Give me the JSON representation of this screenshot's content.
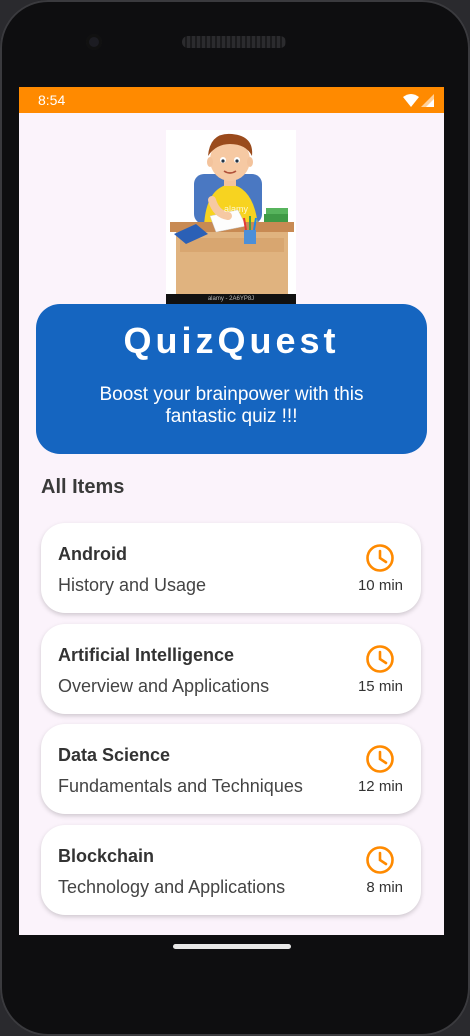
{
  "status": {
    "time": "8:54"
  },
  "hero": {
    "image_caption": "alamy - 2A6YP8J",
    "watermark": "alamy"
  },
  "banner": {
    "title": "QuizQuest",
    "subtitle": "Boost your brainpower with this fantastic quiz !!!"
  },
  "section": {
    "title": "All Items"
  },
  "items": [
    {
      "title": "Android",
      "subtitle": "History and Usage",
      "time": "10 min"
    },
    {
      "title": "Artificial Intelligence",
      "subtitle": "Overview and Applications",
      "time": "15 min"
    },
    {
      "title": "Data Science",
      "subtitle": "Fundamentals and Techniques",
      "time": "12 min"
    },
    {
      "title": "Blockchain",
      "subtitle": "Technology and Applications",
      "time": "8 min"
    }
  ],
  "colors": {
    "accent": "#ff8a00",
    "banner": "#1565c0",
    "background": "#fbf3fb"
  },
  "icons": {
    "status": [
      "wifi-icon",
      "signal-icon"
    ],
    "card": "clock-icon"
  }
}
